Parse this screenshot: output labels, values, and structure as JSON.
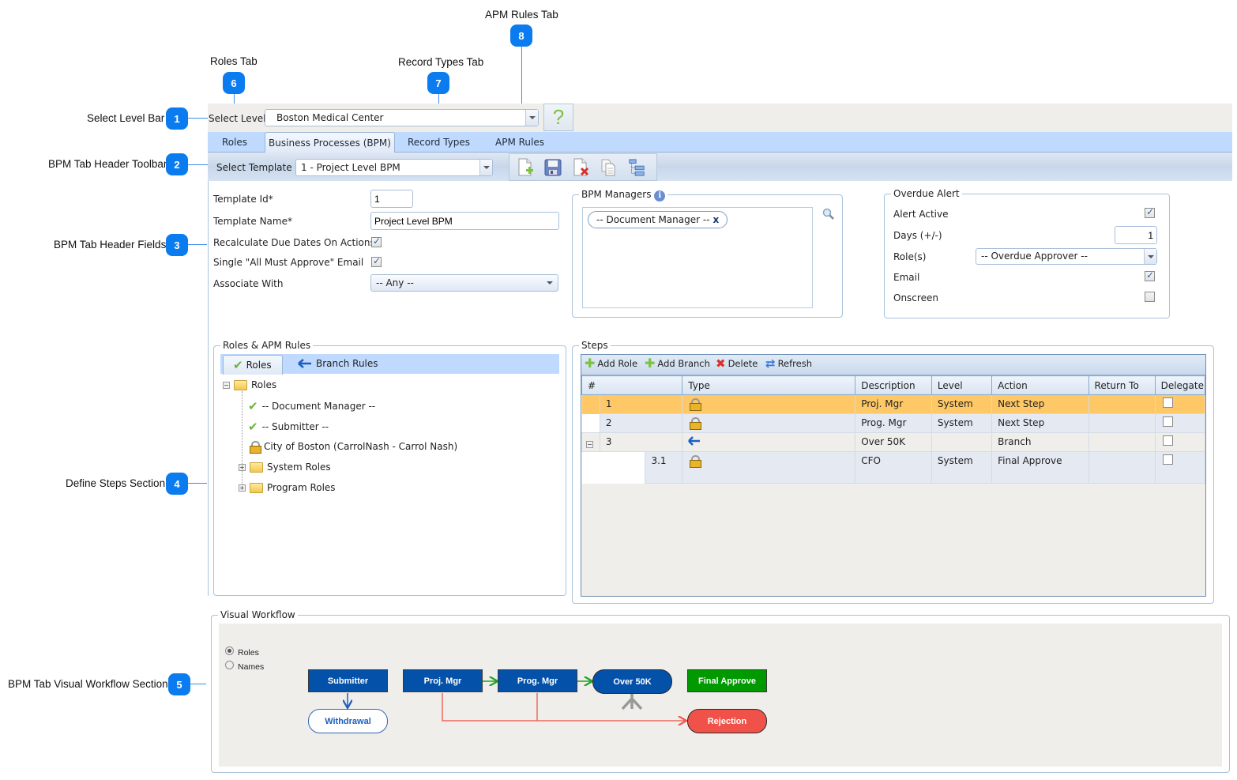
{
  "callouts": [
    {
      "num": "1",
      "label": "Select Level Bar"
    },
    {
      "num": "2",
      "label": "BPM Tab Header Toolbar"
    },
    {
      "num": "3",
      "label": "BPM Tab Header Fields"
    },
    {
      "num": "4",
      "label": "Define Steps Section"
    },
    {
      "num": "5",
      "label": "BPM Tab Visual Workflow Section"
    },
    {
      "num": "6",
      "label": "Roles Tab"
    },
    {
      "num": "7",
      "label": "Record Types Tab"
    },
    {
      "num": "8",
      "label": "APM Rules Tab"
    }
  ],
  "level_bar": {
    "label": "Select Level",
    "value": "Boston Medical Center",
    "help_icon": "?"
  },
  "tabs": [
    {
      "label": "Roles"
    },
    {
      "label": "Business Processes (BPM)",
      "active": true
    },
    {
      "label": "Record Types"
    },
    {
      "label": "APM Rules"
    }
  ],
  "template_bar": {
    "label": "Select Template",
    "value": "1 - Project Level BPM",
    "toolbar_icons": [
      "new-document-icon",
      "save-icon",
      "delete-document-icon",
      "copy-icon",
      "hierarchy-icon"
    ]
  },
  "header_fields": {
    "template_id_label": "Template Id*",
    "template_id_value": "1",
    "template_name_label": "Template Name*",
    "template_name_value": "Project Level BPM",
    "recalc_label": "Recalculate Due Dates On Actions",
    "recalc_checked": true,
    "single_email_label": "Single \"All Must Approve\" Email",
    "single_email_checked": true,
    "associate_label": "Associate With",
    "associate_value": "-- Any --"
  },
  "bpm_managers": {
    "title": "BPM Managers",
    "chips": [
      "-- Document Manager --"
    ],
    "chip_remove": "x"
  },
  "overdue_alert": {
    "title": "Overdue Alert",
    "alert_active_label": "Alert Active",
    "alert_active": true,
    "days_label": "Days (+/-)",
    "days_value": "1",
    "roles_label": "Role(s)",
    "roles_value": "-- Overdue Approver --",
    "email_label": "Email",
    "email": true,
    "onscreen_label": "Onscreen",
    "onscreen": false
  },
  "roles_apm": {
    "title": "Roles & APM Rules",
    "tabs": [
      "Roles",
      "Branch Rules"
    ],
    "tree_root": "Roles",
    "tree_items": [
      {
        "label": "-- Document Manager --",
        "icon": "check"
      },
      {
        "label": "-- Submitter --",
        "icon": "check"
      },
      {
        "label": "City of Boston (CarrolNash - Carrol Nash)",
        "icon": "lock"
      },
      {
        "label": "System Roles",
        "icon": "folder"
      },
      {
        "label": "Program Roles",
        "icon": "folder"
      }
    ]
  },
  "steps": {
    "title": "Steps",
    "toolbar": {
      "add_role": "Add Role",
      "add_branch": "Add Branch",
      "delete": "Delete",
      "refresh": "Refresh"
    },
    "columns": [
      "#",
      "Type",
      "Description",
      "Level",
      "Action",
      "Return To",
      "Delegate"
    ],
    "rows": [
      {
        "num": "1",
        "type": "lock",
        "description": "Proj. Mgr",
        "level": "System",
        "action": "Next Step",
        "return_to": "",
        "delegate": false,
        "selected": true
      },
      {
        "num": "2",
        "type": "lock",
        "description": "Prog. Mgr",
        "level": "System",
        "action": "Next Step",
        "return_to": "",
        "delegate": false
      },
      {
        "num": "3",
        "type": "branch",
        "description": "Over 50K",
        "level": "",
        "action": "Branch",
        "return_to": "",
        "delegate": false
      },
      {
        "num": "3.1",
        "type": "lock",
        "description": "CFO",
        "level": "System",
        "action": "Final Approve",
        "return_to": "",
        "delegate": false
      }
    ]
  },
  "visual_workflow": {
    "title": "Visual Workflow",
    "radio_options": [
      {
        "label": "Roles",
        "selected": true
      },
      {
        "label": "Names",
        "selected": false
      }
    ],
    "nodes": {
      "submitter": "Submitter",
      "withdrawal": "Withdrawal",
      "proj_mgr": "Proj. Mgr",
      "prog_mgr": "Prog. Mgr",
      "over_50k": "Over 50K",
      "final_approve": "Final Approve",
      "rejection": "Rejection"
    },
    "colors": {
      "role": "#0451a9",
      "final": "#009a00",
      "rejection": "#f0524a",
      "approve_arrow": "#22a022",
      "reject_line": "#ee6a5e"
    }
  }
}
